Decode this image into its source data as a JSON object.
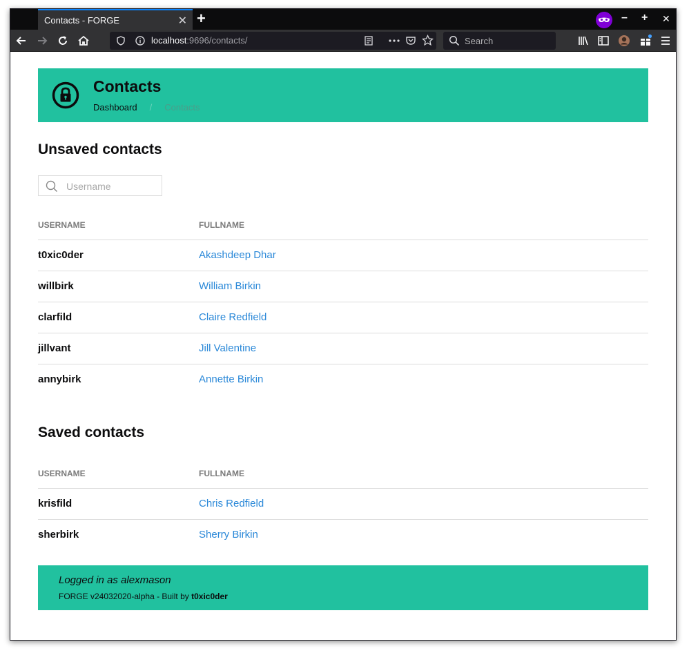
{
  "browser": {
    "tab_title": "Contacts - FORGE",
    "tab_close": "✕",
    "new_tab": "+",
    "window_minimize": "–",
    "window_maximize": "+",
    "window_close": "✕",
    "url_host": "localhost",
    "url_rest": ":9696/contacts/",
    "search_placeholder": "Search"
  },
  "header": {
    "title": "Contacts",
    "breadcrumb_home": "Dashboard",
    "breadcrumb_separator": "/",
    "breadcrumb_current": "Contacts"
  },
  "unsaved": {
    "heading": "Unsaved contacts",
    "filter_placeholder": "Username",
    "columns": [
      "USERNAME",
      "FULLNAME"
    ],
    "rows": [
      {
        "username": "t0xic0der",
        "fullname": "Akashdeep Dhar"
      },
      {
        "username": "willbirk",
        "fullname": "William Birkin"
      },
      {
        "username": "clarfild",
        "fullname": "Claire Redfield"
      },
      {
        "username": "jillvant",
        "fullname": "Jill Valentine"
      },
      {
        "username": "annybirk",
        "fullname": "Annette Birkin"
      }
    ]
  },
  "saved": {
    "heading": "Saved contacts",
    "columns": [
      "USERNAME",
      "FULLNAME"
    ],
    "rows": [
      {
        "username": "krisfild",
        "fullname": "Chris Redfield"
      },
      {
        "username": "sherbirk",
        "fullname": "Sherry Birkin"
      }
    ]
  },
  "footer": {
    "logged_in": "Logged in as alexmason",
    "version_prefix": "FORGE v24032020-alpha - Built by ",
    "author": "t0xic0der"
  },
  "colors": {
    "accent": "#21c19f",
    "link": "#2a88d8",
    "private_badge": "#8000d7"
  }
}
